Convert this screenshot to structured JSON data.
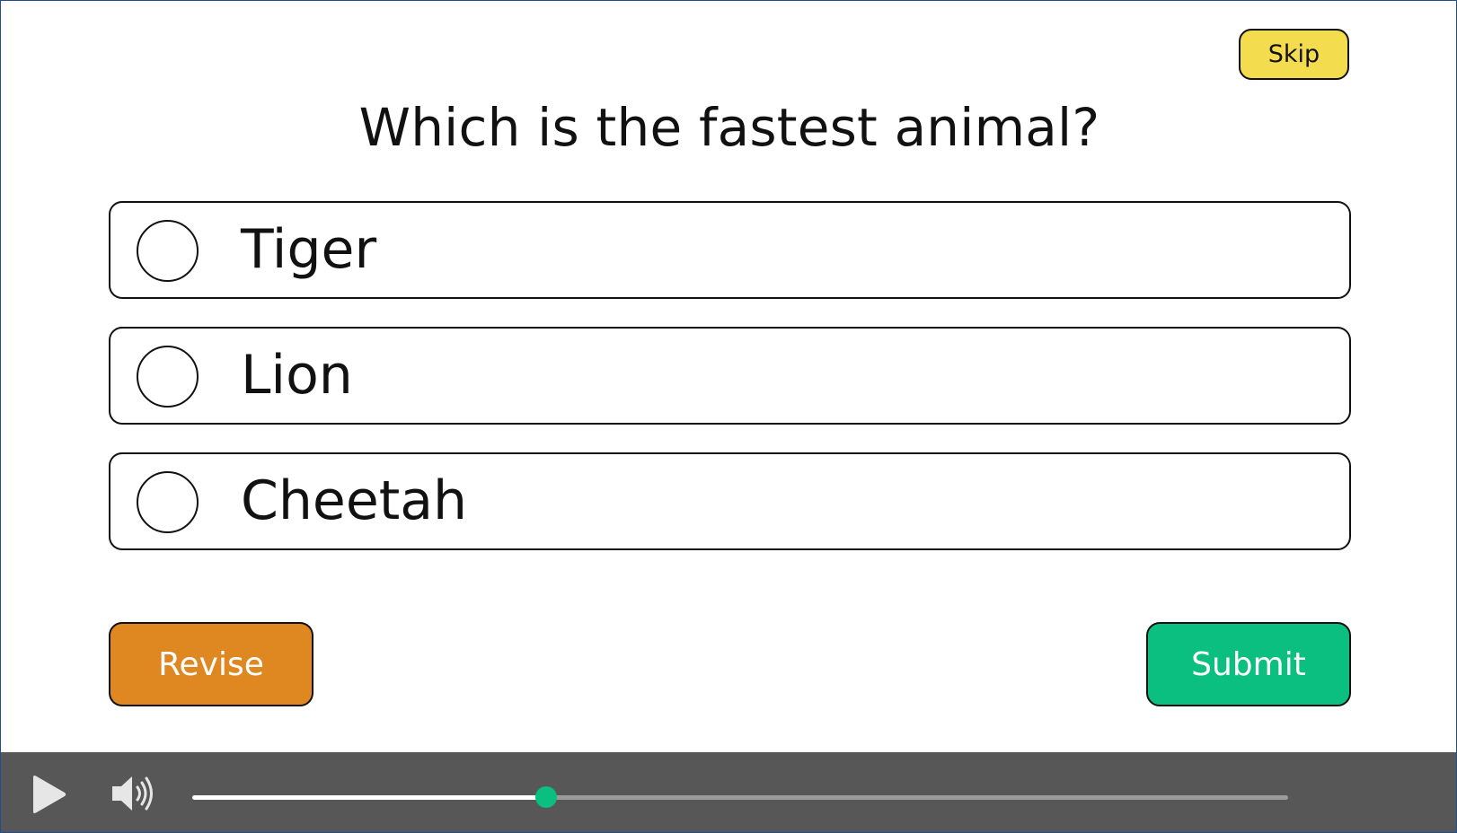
{
  "header": {
    "skip_label": "Skip"
  },
  "question": {
    "text": "Which is the fastest animal?",
    "options": [
      {
        "label": "Tiger",
        "selected": false
      },
      {
        "label": "Lion",
        "selected": false
      },
      {
        "label": "Cheetah",
        "selected": false
      }
    ]
  },
  "actions": {
    "revise_label": "Revise",
    "submit_label": "Submit"
  },
  "player": {
    "play_icon": "play-icon",
    "volume_icon": "volume-icon",
    "progress_fraction": 0.323
  },
  "colors": {
    "skip": "#f4dc4f",
    "revise": "#df8822",
    "submit": "#0bbf80",
    "player_bar": "#575757",
    "progress_thumb": "#0bbf80"
  }
}
